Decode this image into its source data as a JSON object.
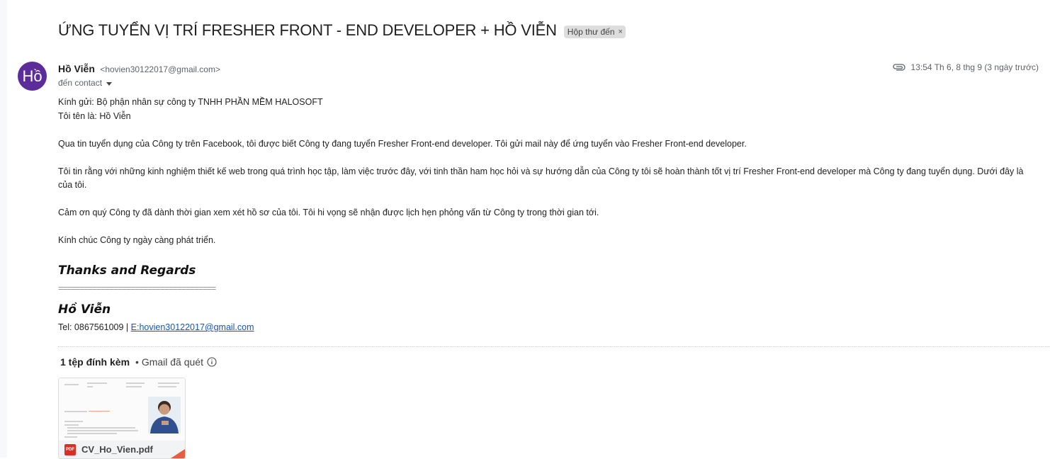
{
  "email": {
    "subject": "ỨNG TUYỂN VỊ TRÍ FRESHER FRONT - END DEVELOPER + HỒ VIỄN",
    "label": "Hộp thư đến",
    "label_close": "×",
    "avatar_initials": "Hồ",
    "sender_name": "Hồ Viễn",
    "sender_email": "<hovien30122017@gmail.com>",
    "to_text": "đến contact",
    "timestamp": "13:54 Th 6, 8 thg 9 (3 ngày trước)"
  },
  "body": {
    "line1": "Kính gửi: Bộ phận nhân sự công ty  TNHH PHẦN MỀM HALOSOFT",
    "line2": "Tôi tên là: Hồ Viễn",
    "para1": "Qua tin tuyển dụng của Công ty trên Facebook, tôi được biết Công ty đang tuyển Fresher Front-end developer. Tôi gửi mail này để ứng tuyển vào Fresher  Front-end  developer.",
    "para2": "Tôi tin rằng với những kinh nghiệm thiết kế web trong quá trình học tập, làm việc trước đây, với tinh thần ham học hỏi và sự hướng dẫn của Công ty tôi sẽ hoàn thành tốt vị trí Fresher  Front-end  developer mà Công ty đang tuyển dụng. Dưới đây là CV của tôi.",
    "para2_line1": "Tôi tin rằng với những kinh nghiệm thiết kế web trong quá trình học tập, làm việc trước đây, với tinh thần ham học hỏi và sự hướng dẫn của Công ty tôi sẽ hoàn thành tốt vị trí Fresher  Front-end  developer mà Công ty đang tuyển dụng. Dưới đây là",
    "para2_line2": "của tôi.",
    "para3": "Cảm ơn quý Công ty đã dành thời gian xem xét hồ sơ của tôi. Tôi hi vọng sẽ nhận được lịch hẹn phỏng vấn từ Công ty trong thời gian tới.",
    "para4": "Kính chúc Công ty ngày càng phát triển."
  },
  "signature": {
    "thanks": "Thanks and Regards",
    "separator": "=====================================",
    "name": "Hồ Viễn",
    "tel": "Tel: 0867561009 | ",
    "email_link": "E:hovien30122017@gmail.com"
  },
  "attachments": {
    "count_label": "1 tệp đính kèm",
    "scan_label": "• Gmail đã quét",
    "file_name": "CV_Ho_Vien.pdf",
    "file_type": "PDF"
  },
  "icons": {
    "attachment": "paperclip-icon",
    "info": "info-icon",
    "pdf": "pdf-icon",
    "dropdown": "caret-down-icon"
  },
  "colors": {
    "avatar_bg": "#5b2c9a",
    "link": "#1155cc",
    "pdf_red": "#d93025"
  }
}
